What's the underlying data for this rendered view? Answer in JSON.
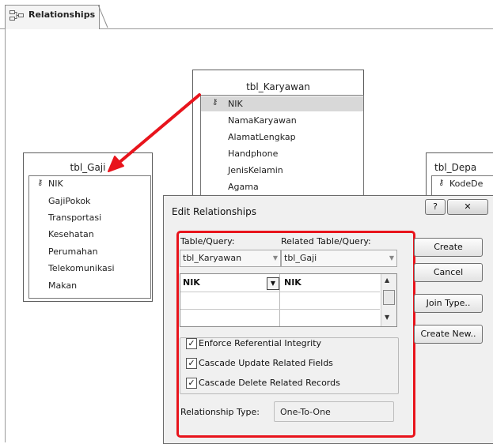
{
  "tab": {
    "label": "Relationships",
    "icon": "relationships-icon"
  },
  "tables": {
    "karyawan": {
      "title": "tbl_Karyawan",
      "fields": [
        "NIK",
        "NamaKaryawan",
        "AlamatLengkap",
        "Handphone",
        "JenisKelamin",
        "Agama"
      ],
      "key_field": "NIK"
    },
    "gaji": {
      "title": "tbl_Gaji",
      "fields": [
        "NIK",
        "GajiPokok",
        "Transportasi",
        "Kesehatan",
        "Perumahan",
        "Telekomunikasi",
        "Makan"
      ],
      "key_field": "NIK"
    },
    "departemen": {
      "title": "tbl_Depa",
      "fields": [
        "KodeDe"
      ],
      "key_field": "KodeDe"
    }
  },
  "dialog": {
    "title": "Edit Relationships",
    "help_label": "?",
    "close_label": "✕",
    "table_query_label": "Table/Query:",
    "related_table_label": "Related Table/Query:",
    "table_value": "tbl_Karyawan",
    "related_value": "tbl_Gaji",
    "grid_rows": [
      [
        "NIK",
        "NIK"
      ],
      [
        "",
        ""
      ],
      [
        "",
        ""
      ]
    ],
    "buttons": {
      "create": "Create",
      "cancel": "Cancel",
      "join_type": "Join Type..",
      "create_new": "Create New.."
    },
    "options": {
      "enforce": "Enforce Referential Integrity",
      "cascade_update": "Cascade Update Related Fields",
      "cascade_delete": "Cascade Delete Related Records"
    },
    "checked": {
      "enforce": true,
      "cascade_update": true,
      "cascade_delete": true
    },
    "check_mark": "✓",
    "relationship_type_label": "Relationship Type:",
    "relationship_type_value": "One-To-One"
  },
  "colors": {
    "highlight_box": "#e8141c",
    "arrow": "#e8141c"
  }
}
